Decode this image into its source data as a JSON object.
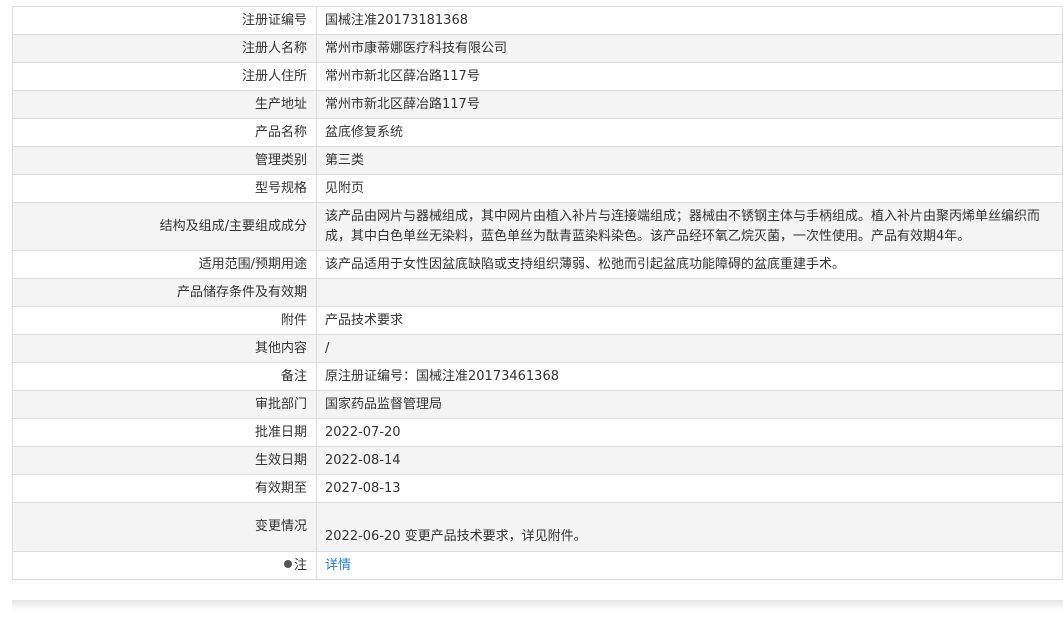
{
  "rows": [
    {
      "label": "注册证编号",
      "value": "国械注准20173181368"
    },
    {
      "label": "注册人名称",
      "value": "常州市康蒂娜医疗科技有限公司"
    },
    {
      "label": "注册人住所",
      "value": "常州市新北区薛冶路117号"
    },
    {
      "label": "生产地址",
      "value": "常州市新北区薛冶路117号"
    },
    {
      "label": "产品名称",
      "value": "盆底修复系统"
    },
    {
      "label": "管理类别",
      "value": "第三类"
    },
    {
      "label": "型号规格",
      "value": "见附页"
    },
    {
      "label": "结构及组成/主要组成成分",
      "value": "该产品由网片与器械组成，其中网片由植入补片与连接端组成；器械由不锈钢主体与手柄组成。植入补片由聚丙烯单丝编织而成，其中白色单丝无染料，蓝色单丝为酞青蓝染料染色。该产品经环氧乙烷灭菌，一次性使用。产品有效期4年。"
    },
    {
      "label": "适用范围/预期用途",
      "value": "该产品适用于女性因盆底缺陷或支持组织薄弱、松弛而引起盆底功能障碍的盆底重建手术。"
    },
    {
      "label": "产品储存条件及有效期",
      "value": ""
    },
    {
      "label": "附件",
      "value": "产品技术要求"
    },
    {
      "label": "其他内容",
      "value": "/"
    },
    {
      "label": "备注",
      "value": "原注册证编号：国械注准20173461368"
    },
    {
      "label": "审批部门",
      "value": "国家药品监督管理局"
    },
    {
      "label": "批准日期",
      "value": "2022-07-20"
    },
    {
      "label": "生效日期",
      "value": "2022-08-14"
    },
    {
      "label": "有效期至",
      "value": "2027-08-13"
    },
    {
      "label": "变更情况",
      "value": "2022-06-20 变更产品技术要求，详见附件。"
    }
  ],
  "note": {
    "label": "注",
    "icon": "lightbulb-icon",
    "link_text": "详情",
    "link_color": "#2a7fc9"
  }
}
